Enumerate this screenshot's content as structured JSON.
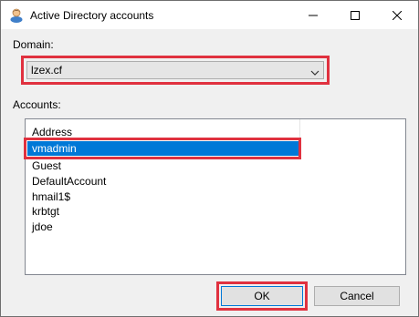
{
  "window": {
    "title": "Active Directory accounts",
    "icon": "user-icon"
  },
  "title_buttons": {
    "minimize_icon": "minimize-icon",
    "maximize_icon": "maximize-icon",
    "close_icon": "close-icon"
  },
  "domain": {
    "label": "Domain:",
    "selected": "lzex.cf"
  },
  "accounts": {
    "label": "Accounts:",
    "column_header": "Address",
    "items": [
      "vmadmin",
      "Guest",
      "DefaultAccount",
      "hmail1$",
      "krbtgt",
      "jdoe"
    ],
    "selected_index": 0
  },
  "buttons": {
    "ok": "OK",
    "cancel": "Cancel"
  },
  "colors": {
    "highlight": "#e0313f",
    "selection": "#0078d7",
    "dialog_bg": "#f0f0f0"
  }
}
